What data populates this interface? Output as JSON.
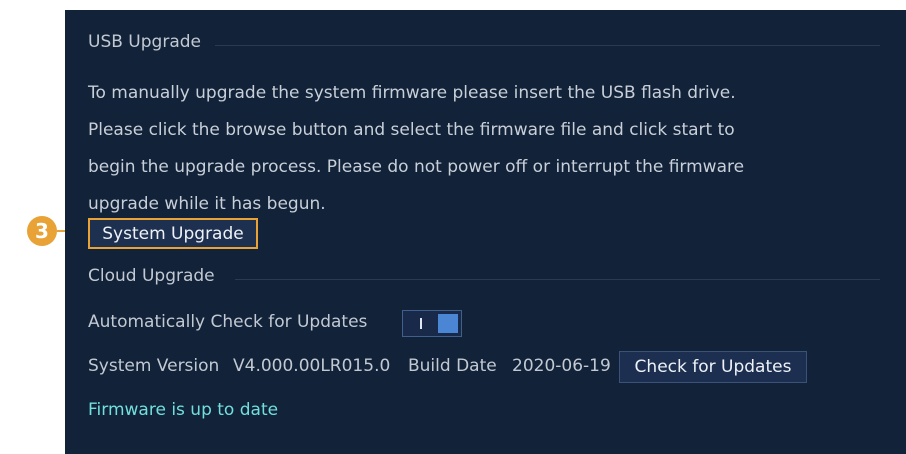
{
  "usb_upgrade": {
    "title": "USB Upgrade",
    "description_lines": [
      "To manually upgrade the system firmware please insert the USB flash drive.",
      "Please click the browse button and select the firmware file and click start to",
      "begin the upgrade process. Please do not power off or interrupt the firmware",
      "upgrade while it has begun."
    ],
    "system_upgrade_button": "System Upgrade"
  },
  "cloud_upgrade": {
    "title": "Cloud Upgrade",
    "auto_check_label": "Automatically Check for Updates",
    "auto_check_enabled": true,
    "system_version_label": "System Version",
    "system_version_value": "V4.000.00LR015.0",
    "build_date_label": "Build Date",
    "build_date_value": "2020-06-19",
    "check_updates_button": "Check for Updates",
    "status_message": "Firmware is up to date"
  },
  "callout": {
    "number": "3",
    "color": "#e8a236"
  },
  "colors": {
    "panel_bg": "#122239",
    "status_text": "#71e0dd",
    "toggle_on": "#4a86d4"
  }
}
